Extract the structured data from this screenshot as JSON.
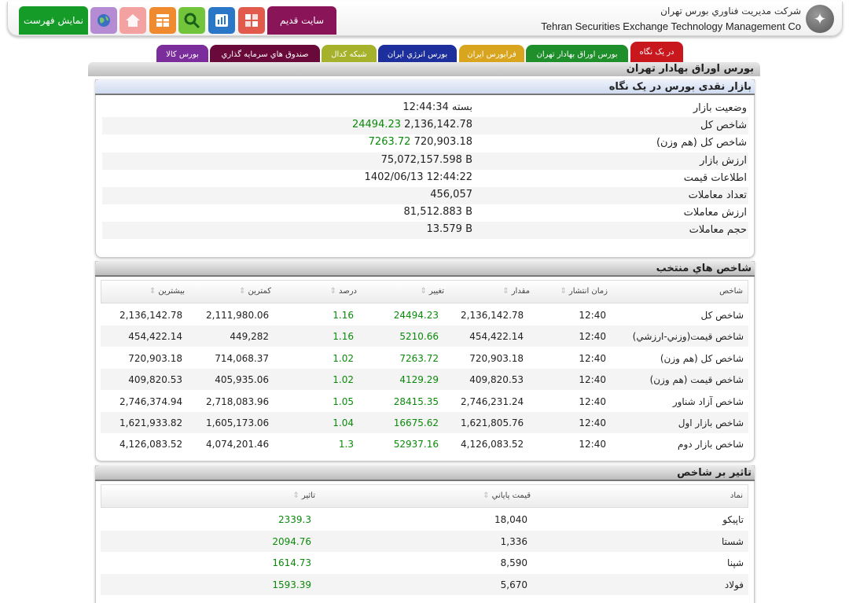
{
  "header": {
    "company_fa": "شرکت مديريت فناوري بورس تهران",
    "company_en": "Tehran Securities Exchange Technology Management Co",
    "old_site_label": "سايت قديم",
    "show_menu_label": "نمايش فهرست",
    "icons": [
      "chart-icon",
      "book-icon",
      "dashboard-icon",
      "search-icon",
      "calculator-icon",
      "home-icon",
      "globe-icon"
    ]
  },
  "tabs": [
    {
      "label": "در يک نگاه",
      "color": "#c8181e",
      "active": true
    },
    {
      "label": "بورس اوراق بهادار تهران",
      "color": "#1f8f2b",
      "active": false
    },
    {
      "label": "فرابورس ايران",
      "color": "#d9a51f",
      "active": false
    },
    {
      "label": "بورس انرژي ايران",
      "color": "#1d2f9c",
      "active": false
    },
    {
      "label": "شبکه کدال",
      "color": "#a6b22b",
      "active": false
    },
    {
      "label": "صندوق هاي سرمايه گذاري",
      "color": "#6a0a3a",
      "active": false
    },
    {
      "label": "بورس کالا",
      "color": "#7b2d9b",
      "active": false
    }
  ],
  "main_title": "بورس اوراق بهادار تهران",
  "overview": {
    "title": "بازار نقدی بورس در يک نگاه",
    "rows": [
      {
        "label": "وضعيت بازار",
        "value": "بسته 12:44:34",
        "change": ""
      },
      {
        "label": "شاخص کل",
        "value": "2,136,142.78",
        "change": "24494.23"
      },
      {
        "label": "شاخص کل (هم وزن)",
        "value": "720,903.18",
        "change": "7263.72"
      },
      {
        "label": "ارزش بازار",
        "value": "75,072,157.598 B",
        "change": ""
      },
      {
        "label": "اطلاعات قيمت",
        "value": "1402/06/13 12:44:22",
        "change": ""
      },
      {
        "label": "تعداد معاملات",
        "value": "456,057",
        "change": ""
      },
      {
        "label": "ارزش معاملات",
        "value": "81,512.883 B",
        "change": ""
      },
      {
        "label": "حجم معاملات",
        "value": "13.579 B",
        "change": ""
      }
    ]
  },
  "selected_indices": {
    "title": "شاخص هاي منتخب",
    "headers": [
      "شاخص",
      "زمان انتشار",
      "مقدار",
      "تغيير",
      "درصد",
      "کمترين",
      "بيشترين"
    ],
    "rows": [
      {
        "name": "شاخص کل",
        "time": "12:40",
        "value": "2,136,142.78",
        "change": "24494.23",
        "percent": "1.16",
        "min": "2,111,980.06",
        "max": "2,136,142.78"
      },
      {
        "name": "شاخص قيمت(وزني-ارزشي)",
        "time": "12:40",
        "value": "454,422.14",
        "change": "5210.66",
        "percent": "1.16",
        "min": "449,282",
        "max": "454,422.14"
      },
      {
        "name": "شاخص کل (هم وزن)",
        "time": "12:40",
        "value": "720,903.18",
        "change": "7263.72",
        "percent": "1.02",
        "min": "714,068.37",
        "max": "720,903.18"
      },
      {
        "name": "شاخص قيمت (هم وزن)",
        "time": "12:40",
        "value": "409,820.53",
        "change": "4129.29",
        "percent": "1.02",
        "min": "405,935.06",
        "max": "409,820.53"
      },
      {
        "name": "شاخص آزاد شناور",
        "time": "12:40",
        "value": "2,746,231.24",
        "change": "28415.35",
        "percent": "1.05",
        "min": "2,718,083.96",
        "max": "2,746,374.94"
      },
      {
        "name": "شاخص بازار اول",
        "time": "12:40",
        "value": "1,621,805.76",
        "change": "16675.62",
        "percent": "1.04",
        "min": "1,605,173.06",
        "max": "1,621,933.82"
      },
      {
        "name": "شاخص بازار دوم",
        "time": "12:40",
        "value": "4,126,083.52",
        "change": "52937.16",
        "percent": "1.3",
        "min": "4,074,201.46",
        "max": "4,126,083.52"
      }
    ]
  },
  "impact": {
    "title": "تاثير بر شاخص",
    "headers": [
      "نماد",
      "قيمت پاياني",
      "تاثير"
    ],
    "rows": [
      {
        "symbol": "تاپيکو",
        "price": "18,040",
        "impact": "2339.3"
      },
      {
        "symbol": "شستا",
        "price": "1,336",
        "impact": "2094.76"
      },
      {
        "symbol": "شپنا",
        "price": "8,590",
        "impact": "1614.73"
      },
      {
        "symbol": "فولاد",
        "price": "5,670",
        "impact": "1593.39"
      }
    ]
  },
  "colors": {
    "positive": "#0a8a0a"
  }
}
